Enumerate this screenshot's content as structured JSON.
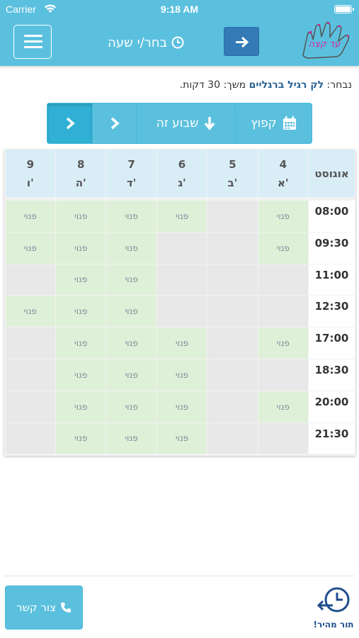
{
  "status_bar": {
    "carrier": "Carrier",
    "time": "9:18 AM"
  },
  "header": {
    "title": "בחר/י שעה",
    "logo_text": "עד קצה"
  },
  "selected": {
    "prefix": "נבחר:",
    "service": "לק רגיל ברגליים",
    "duration_label": "משך:",
    "duration_value": "30 דקות."
  },
  "toolbar": {
    "jump_label": "קפוץ",
    "this_week_label": "שבוע זה"
  },
  "calendar": {
    "month": "אוגוסט",
    "days": [
      {
        "date": "4",
        "day": "א'"
      },
      {
        "date": "5",
        "day": "ב'"
      },
      {
        "date": "6",
        "day": "ג'"
      },
      {
        "date": "7",
        "day": "ד'"
      },
      {
        "date": "8",
        "day": "ה'"
      },
      {
        "date": "9",
        "day": "ו'"
      }
    ],
    "free_label": "פנוי",
    "rows": [
      {
        "time": "08:00",
        "free": [
          true,
          false,
          true,
          true,
          true,
          true
        ]
      },
      {
        "time": "09:30",
        "free": [
          true,
          false,
          false,
          true,
          true,
          true
        ]
      },
      {
        "time": "11:00",
        "free": [
          false,
          false,
          false,
          true,
          true,
          false
        ]
      },
      {
        "time": "12:30",
        "free": [
          false,
          false,
          false,
          true,
          true,
          true
        ]
      },
      {
        "time": "17:00",
        "free": [
          true,
          false,
          true,
          true,
          true,
          false
        ]
      },
      {
        "time": "18:30",
        "free": [
          false,
          false,
          true,
          true,
          true,
          false
        ]
      },
      {
        "time": "20:00",
        "free": [
          true,
          false,
          true,
          true,
          true,
          false
        ]
      },
      {
        "time": "21:30",
        "free": [
          false,
          false,
          true,
          true,
          true,
          false
        ]
      }
    ]
  },
  "footer": {
    "contact_label": "צור קשר",
    "quick_label": "תור מהיר!"
  },
  "colors": {
    "primary": "#5bc0de",
    "dark_blue": "#337ab7",
    "free_slot": "#dff0d8",
    "taken_slot": "#e8e8e8",
    "header_cell": "#d9edf7"
  }
}
